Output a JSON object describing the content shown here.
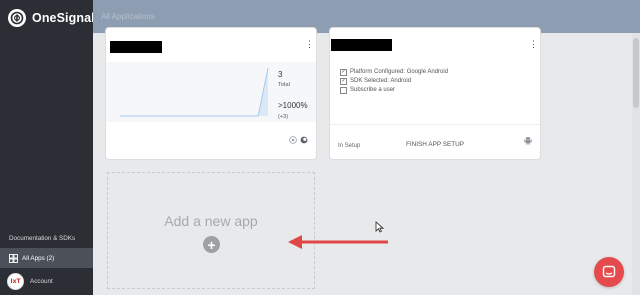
{
  "sidebar": {
    "brand": "OneSignal",
    "docs_link": "Documentation & SDKs",
    "all_apps": "All Apps (2)",
    "account": "Account",
    "avatar_text": "IxT"
  },
  "header": {
    "title": "All Applications"
  },
  "apps": [
    {
      "stats": {
        "total_value": "3",
        "total_label": "Total",
        "change_value": ">1000%",
        "change_sub": "(+3)"
      },
      "chart_data": {
        "type": "area",
        "x": [
          1,
          2,
          3,
          4,
          5,
          6,
          7,
          8,
          9,
          10,
          11,
          12,
          13,
          14,
          15,
          16
        ],
        "values": [
          0,
          0,
          0,
          0,
          0,
          0,
          0,
          0,
          0,
          0,
          0,
          0,
          0,
          0,
          0,
          3
        ],
        "ylim": [
          0,
          3
        ]
      }
    },
    {
      "checklist": [
        {
          "label": "Platform Configured: Google Android",
          "checked": true
        },
        {
          "label": "SDK Selected: Android",
          "checked": true
        },
        {
          "label": "Subscribe a user",
          "checked": false
        }
      ],
      "finish_label": "FINISH APP SETUP",
      "status": "In Setup"
    }
  ],
  "add_app": {
    "label": "Add a new app",
    "plus": "+"
  },
  "colors": {
    "sidebar": "#2b2e34",
    "header": "#8e9eb2",
    "accent_red": "#e54b4d",
    "chart_line": "#a9c8ec"
  }
}
